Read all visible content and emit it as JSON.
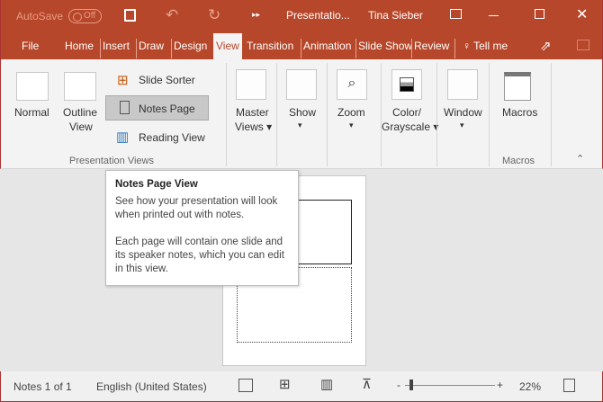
{
  "titlebar": {
    "autosave": "AutoSave",
    "toggle": "Off",
    "doc_title": "Presentatio...",
    "user": "Tina Sieber"
  },
  "tabs": [
    "File",
    "Home",
    "Insert",
    "Draw",
    "Design",
    "View",
    "Transition",
    "Animation",
    "Slide Show",
    "Review",
    "Tell me"
  ],
  "ribbon": {
    "presentation_views": {
      "normal": "Normal",
      "outline_1": "Outline",
      "outline_2": "View",
      "slide_sorter": "Slide Sorter",
      "notes_page": "Notes Page",
      "reading_view": "Reading View",
      "group": "Presentation Views"
    },
    "master_1": "Master",
    "master_2": "Views",
    "show": "Show",
    "zoom": "Zoom",
    "color_1": "Color/",
    "color_2": "Grayscale",
    "window": "Window",
    "macros": "Macros",
    "macros_group": "Macros"
  },
  "tooltip": {
    "title": "Notes Page View",
    "p1": "See how your presentation will look when printed out with notes.",
    "p2": "Each page will contain one slide and its speaker notes, which you can edit in this view."
  },
  "status": {
    "notes": "Notes 1 of 1",
    "language": "English (United States)",
    "zoom": "22%",
    "zoom_percent": 22
  },
  "colors": {
    "accent": "#b7472a"
  }
}
